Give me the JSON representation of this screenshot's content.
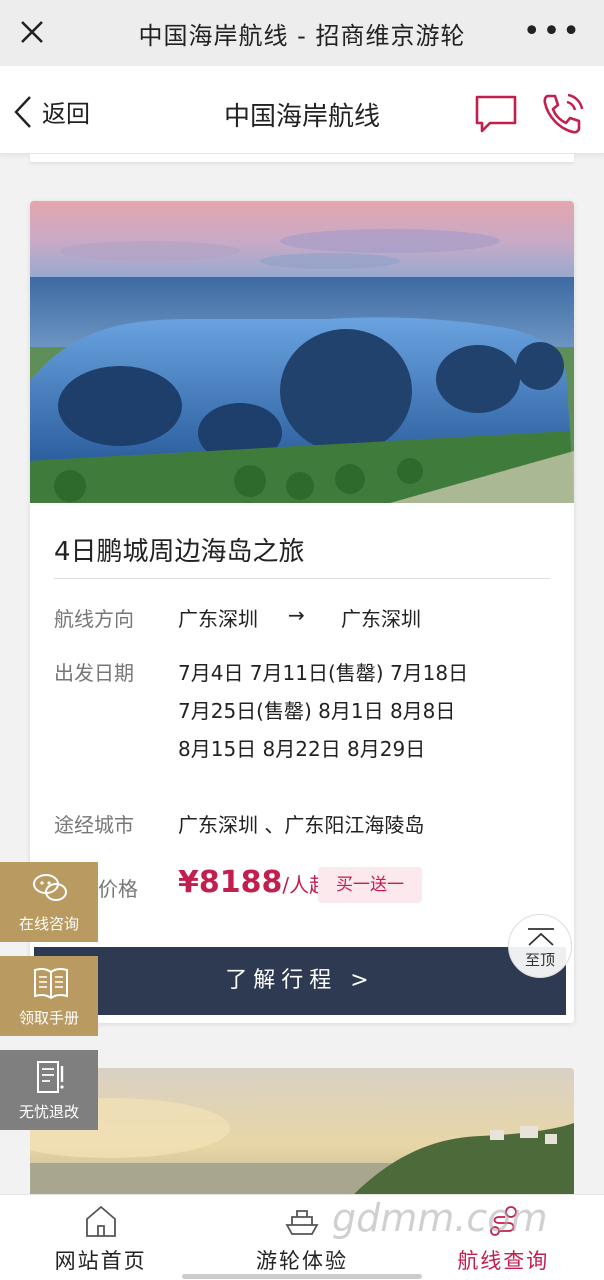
{
  "wechat_bar": {
    "title": "中国海岸航线 - 招商维京游轮",
    "more": "•••"
  },
  "header": {
    "back_label": "返回",
    "title": "中国海岸航线"
  },
  "card": {
    "title": "4日鹏城周边海岛之旅",
    "route_label": "航线方向",
    "route_from": "广东深圳",
    "route_arrow": "→",
    "route_to": "广东深圳",
    "dates_label": "出发日期",
    "dates_lines": [
      "7月4日 7月11日(售罄) 7月18日",
      "7月25日(售罄) 8月1日 8月8日",
      "8月15日 8月22日 8月29日"
    ],
    "cities_label": "途经城市",
    "cities": "广东深圳 、广东阳江海陵岛",
    "price_label": "价格",
    "price_value": "¥8188",
    "price_unit": "/人起",
    "promo": "买一送一",
    "cta": "了解行程 >"
  },
  "side_buttons": {
    "consult": "在线咨询",
    "brochure": "领取手册",
    "refund": "无忧退改"
  },
  "to_top": "至顶",
  "bottom_nav": {
    "home": "网站首页",
    "cruise": "游轮体验",
    "routes": "航线查询"
  },
  "watermark": "gdmm.com",
  "colors": {
    "accent": "#c31f4e",
    "cta_bg": "#2e3a52",
    "side_gold": "#b99a61",
    "side_gray": "#7f7f7f"
  }
}
